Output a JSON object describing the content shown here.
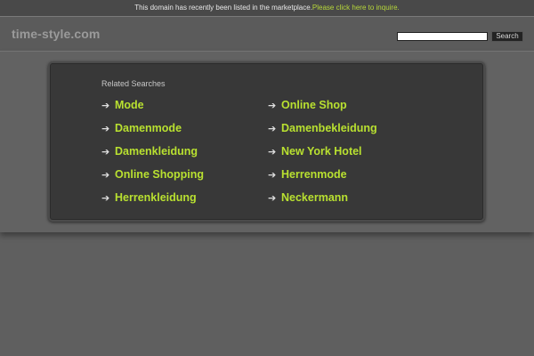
{
  "topbar": {
    "notice": "This domain has recently been listed in the marketplace.",
    "inquire_link": "Please click here to inquire."
  },
  "header": {
    "site_title": "time-style.com",
    "search_placeholder": "",
    "search_button": "Search"
  },
  "related": {
    "heading": "Related Searches",
    "left": [
      {
        "label": "Mode"
      },
      {
        "label": "Damenmode"
      },
      {
        "label": "Damenkleidung"
      },
      {
        "label": "Online Shopping"
      },
      {
        "label": "Herrenkleidung"
      }
    ],
    "right": [
      {
        "label": "Online Shop"
      },
      {
        "label": "Damenbekleidung"
      },
      {
        "label": "New York Hotel"
      },
      {
        "label": "Herrenmode"
      },
      {
        "label": "Neckermann"
      }
    ]
  },
  "colors": {
    "accent_link": "#b9e130",
    "background": "#5f5f5f",
    "panel": "#383838"
  },
  "icons": {
    "link_arrow": "arrow-right-icon"
  }
}
